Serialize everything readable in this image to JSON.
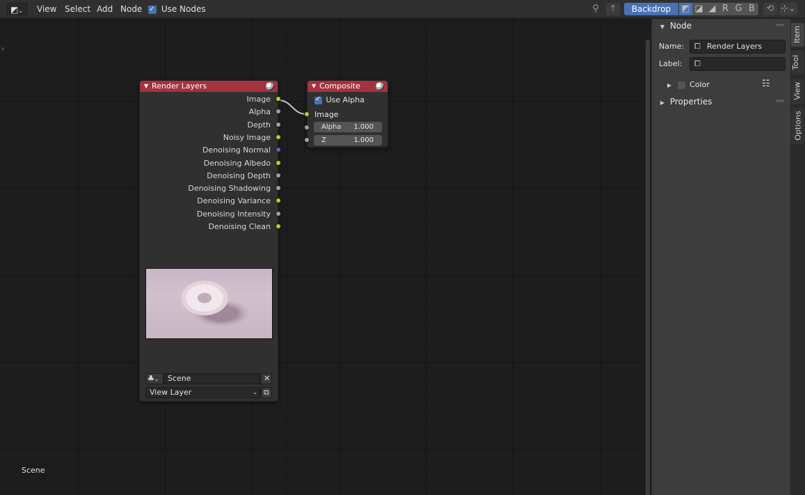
{
  "header": {
    "menu": [
      "View",
      "Select",
      "Add",
      "Node"
    ],
    "use_nodes_label": "Use Nodes",
    "use_nodes_checked": true,
    "backdrop_label": "Backdrop",
    "channels": [
      "R",
      "G",
      "B"
    ]
  },
  "canvas": {
    "scene_label": "Scene"
  },
  "render_layers_node": {
    "title": "Render Layers",
    "outputs": [
      {
        "label": "Image",
        "socket": "yellow"
      },
      {
        "label": "Alpha",
        "socket": "grey"
      },
      {
        "label": "Depth",
        "socket": "grey"
      },
      {
        "label": "Noisy Image",
        "socket": "yellow"
      },
      {
        "label": "Denoising Normal",
        "socket": "blue"
      },
      {
        "label": "Denoising Albedo",
        "socket": "yellow"
      },
      {
        "label": "Denoising Depth",
        "socket": "grey"
      },
      {
        "label": "Denoising Shadowing",
        "socket": "grey"
      },
      {
        "label": "Denoising Variance",
        "socket": "yellow"
      },
      {
        "label": "Denoising Intensity",
        "socket": "grey"
      },
      {
        "label": "Denoising Clean",
        "socket": "yellow"
      }
    ],
    "scene_field": "Scene",
    "view_layer_field": "View Layer"
  },
  "composite_node": {
    "title": "Composite",
    "use_alpha_label": "Use Alpha",
    "use_alpha_checked": true,
    "image_input": "Image",
    "alpha_label": "Alpha",
    "alpha_value": "1.000",
    "z_label": "Z",
    "z_value": "1.000"
  },
  "sidebar": {
    "node_panel_title": "Node",
    "name_label": "Name:",
    "name_value": "Render Layers",
    "label_label": "Label:",
    "label_value": "",
    "color_label": "Color",
    "properties_title": "Properties",
    "tabs": [
      "Item",
      "Tool",
      "View",
      "Options"
    ],
    "active_tab": "Item"
  },
  "colors": {
    "node_header": "#a5323f",
    "accent": "#4772b3",
    "socket_yellow": "#c7c729",
    "socket_grey": "#a1a1a1",
    "socket_blue": "#6363c7"
  }
}
